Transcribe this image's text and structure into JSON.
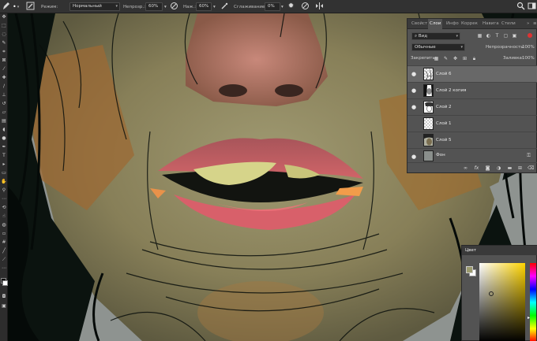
{
  "options_bar": {
    "mode_label": "Режим:",
    "mode_value": "Нормальный",
    "opacity_label": "Непрозр.:",
    "opacity_value": "60%",
    "pressure_label": "Наж.:",
    "pressure_value": "60%",
    "smoothing_label": "Сглаживание:",
    "smoothing_value": "0%",
    "brush_size": "•",
    "icons": [
      "brush-icon",
      "brush-preset-icon",
      "brush-panel-icon",
      "pressure-opacity-icon",
      "airbrush-icon",
      "pressure-size-icon",
      "settings-gear-icon",
      "symmetry-icon",
      "search-icon",
      "workspace-icon"
    ]
  },
  "layers_panel": {
    "tabs": [
      "Свойст",
      "Слои",
      "Инфо",
      "Коррек",
      "Навига",
      "Стили"
    ],
    "active_tab": "Слои",
    "filter_label": "Вид",
    "blend_mode": "Обычные",
    "opacity_label": "Непрозрачность:",
    "opacity_value": "100%",
    "lock_label": "Закрепить:",
    "fill_label": "Заливка:",
    "fill_value": "100%",
    "layers": [
      {
        "name": "Слой 6",
        "visible": true,
        "selected": true,
        "thumb": "sketch"
      },
      {
        "name": "Слой 2 копия",
        "visible": true,
        "selected": false,
        "thumb": "face"
      },
      {
        "name": "Слой 2",
        "visible": true,
        "selected": false,
        "thumb": "face-light"
      },
      {
        "name": "Слой 1",
        "visible": false,
        "selected": false,
        "thumb": "transparent"
      },
      {
        "name": "Слой 5",
        "visible": false,
        "selected": false,
        "thumb": "portrait"
      },
      {
        "name": "Фон",
        "visible": true,
        "selected": false,
        "thumb": "gray",
        "locked": true
      }
    ]
  },
  "color_panel": {
    "title": "Цвет",
    "foreground_color": "#9b9a6e",
    "background_color": "#ffffff",
    "hue_color": "#ffd400"
  },
  "colors": {
    "canvas_bg": "#8e9390",
    "skin": "#8c8660",
    "lips": "#c45a5a",
    "hair": "#0c1410"
  }
}
